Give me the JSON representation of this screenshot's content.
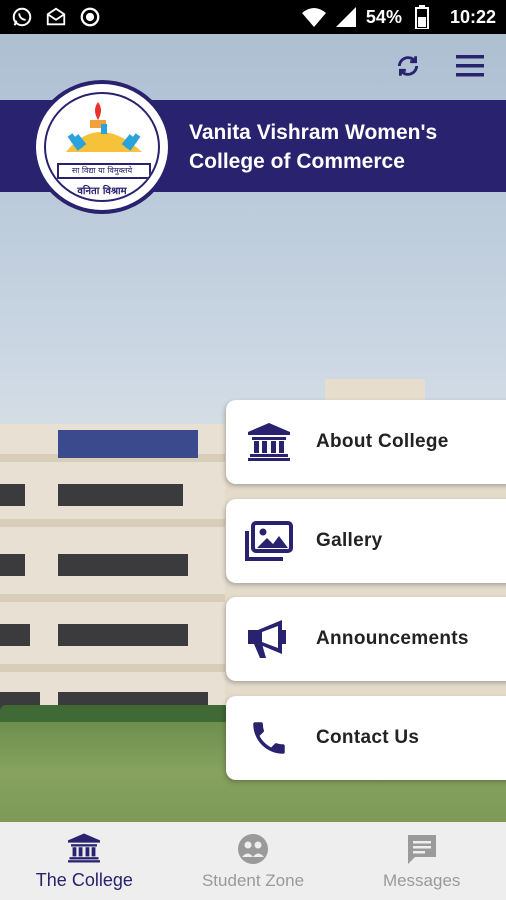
{
  "status_bar": {
    "battery": "54%",
    "time": "10:22",
    "icons": [
      "whatsapp-icon",
      "mail-icon",
      "record-icon",
      "wifi-icon",
      "signal-icon",
      "battery-icon"
    ]
  },
  "header": {
    "college_name_line1": "Vanita Vishram Women's",
    "college_name_line2": "College of Commerce",
    "logo_text_top": "सा विद्या या विमुक्तये",
    "logo_text_bottom": "वनिता विश्राम",
    "actions": [
      {
        "icon": "refresh-icon"
      },
      {
        "icon": "menu-icon"
      }
    ]
  },
  "menu": [
    {
      "label": "About College",
      "icon": "institution-icon"
    },
    {
      "label": "Gallery",
      "icon": "gallery-icon"
    },
    {
      "label": "Announcements",
      "icon": "megaphone-icon"
    },
    {
      "label": "Contact Us",
      "icon": "phone-icon"
    }
  ],
  "bottom_nav": [
    {
      "label": "The College",
      "icon": "institution-icon",
      "active": true
    },
    {
      "label": "Student Zone",
      "icon": "student-zone-icon",
      "active": false
    },
    {
      "label": "Messages",
      "icon": "message-icon",
      "active": false
    }
  ],
  "colors": {
    "brand": "#28226f",
    "card_bg": "#ffffff",
    "nav_bg": "#eeeeee",
    "inactive": "#9a9a9a"
  }
}
